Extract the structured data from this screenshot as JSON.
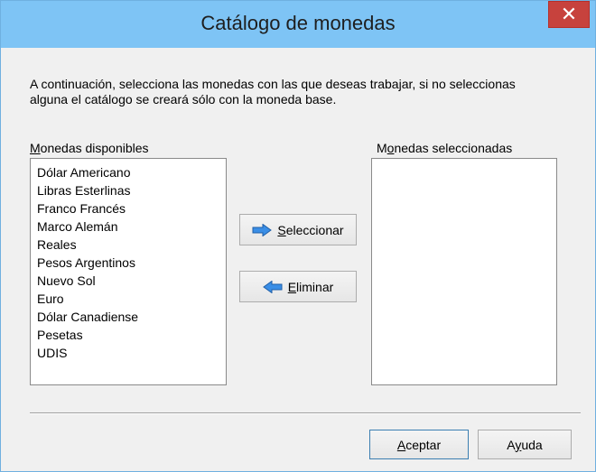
{
  "window": {
    "title": "Catálogo de monedas",
    "close_glyph": "✕"
  },
  "instructions": "A continuación, selecciona las monedas con las que deseas trabajar, si no seleccionas alguna el catálogo se creará sólo con la moneda base.",
  "available": {
    "label_first": "M",
    "label_rest": "onedas disponibles",
    "items": [
      "Dólar Americano",
      "Libras Esterlinas",
      "Franco Francés",
      "Marco Alemán",
      "Reales",
      "Pesos Argentinos",
      "Nuevo Sol",
      "Euro",
      "Dólar Canadiense",
      "Pesetas",
      "UDIS"
    ]
  },
  "selected": {
    "label_pre": "M",
    "label_ul": "o",
    "label_rest": "nedas seleccionadas",
    "items": []
  },
  "buttons": {
    "select": {
      "ul": "S",
      "rest": "eleccionar",
      "icon": "arrow-right-icon"
    },
    "remove": {
      "ul": "E",
      "rest": "liminar",
      "icon": "arrow-left-icon"
    },
    "accept": {
      "ul": "A",
      "rest": "ceptar"
    },
    "help": {
      "pre": "A",
      "ul": "y",
      "rest": "uda"
    }
  },
  "colors": {
    "titlebar": "#7ec4f5",
    "close": "#c7423d",
    "arrow": "#3a8ee6"
  }
}
